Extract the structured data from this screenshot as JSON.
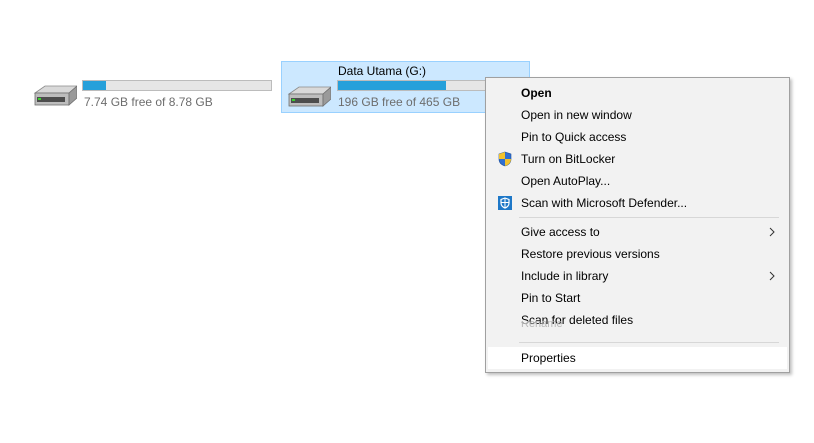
{
  "drives": [
    {
      "name": "",
      "free_text": "7.74 GB free of 8.78 GB",
      "used_fraction": 0.12,
      "icon": "hard-drive-icon"
    },
    {
      "name": "Data Utama (G:)",
      "free_text": "196 GB free of 465 GB",
      "used_fraction": 0.58,
      "icon": "hard-drive-icon",
      "selected": true
    }
  ],
  "context_menu": {
    "items": [
      {
        "label": "Open",
        "bold": true
      },
      {
        "label": "Open in new window"
      },
      {
        "label": "Pin to Quick access"
      },
      {
        "label": "Turn on BitLocker",
        "icon": "shield-uac-icon"
      },
      {
        "label": "Open AutoPlay..."
      },
      {
        "label": "Scan with Microsoft Defender...",
        "icon": "defender-icon"
      },
      {
        "label": "Give access to",
        "submenu": true
      },
      {
        "label": "Restore previous versions"
      },
      {
        "label": "Include in library",
        "submenu": true
      },
      {
        "label": "Pin to Start"
      },
      {
        "label": "Scan for deleted files"
      },
      {
        "label": "Properties",
        "hover": true
      }
    ],
    "partially_hidden_label": "Rename"
  },
  "colors": {
    "bar_fill": "#26a0da",
    "selection_bg": "#cce8ff",
    "selection_border": "#99d1ff",
    "menu_bg": "#f2f2f2"
  }
}
